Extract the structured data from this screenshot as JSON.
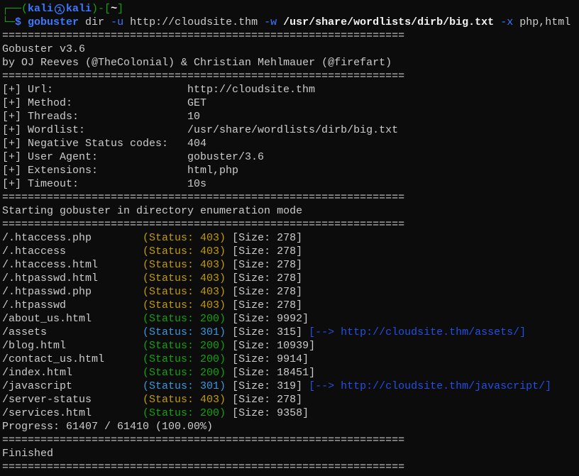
{
  "colors": {
    "background": "#0c0c0c",
    "foreground": "#cccccc",
    "bright_foreground": "#f2f2f2",
    "prompt_frame": "#13a10e",
    "prompt_user": "#3b78ff",
    "command_highlight": "#3b78ff",
    "redirect": "#2350e0",
    "status": {
      "200": "#13a10e",
      "301": "#3a96dd",
      "403": "#c19c00"
    }
  },
  "prompt": {
    "frame_open": "┌──(",
    "user": "kali",
    "symbol_icon": "korean-standard-symbol-icon",
    "host": "kali",
    "frame_mid": ")-[",
    "cwd": "~",
    "frame_close": "]",
    "frame_bottom": "└─",
    "sigil": "$"
  },
  "command": {
    "program": "gobuster",
    "mode": "dir",
    "url_flag": "-u",
    "url": "http://cloudsite.thm",
    "wordlist_flag": "-w",
    "wordlist": "/usr/share/wordlists/dirb/big.txt",
    "ext_flag": "-x",
    "extensions": "php,html"
  },
  "separator": "===============================================================",
  "banner": {
    "version": "Gobuster v3.6",
    "authors": "by OJ Reeves (@TheColonial) & Christian Mehlmauer (@firefart)"
  },
  "config": [
    {
      "label": "[+] Url:",
      "value": "http://cloudsite.thm"
    },
    {
      "label": "[+] Method:",
      "value": "GET"
    },
    {
      "label": "[+] Threads:",
      "value": "10"
    },
    {
      "label": "[+] Wordlist:",
      "value": "/usr/share/wordlists/dirb/big.txt"
    },
    {
      "label": "[+] Negative Status codes:",
      "value": "404"
    },
    {
      "label": "[+] User Agent:",
      "value": "gobuster/3.6"
    },
    {
      "label": "[+] Extensions:",
      "value": "html,php"
    },
    {
      "label": "[+] Timeout:",
      "value": "10s"
    }
  ],
  "start_message": "Starting gobuster in directory enumeration mode",
  "results": [
    {
      "path": "/.htaccess.php",
      "status": "(Status: 403)",
      "size": "[Size: 278]"
    },
    {
      "path": "/.htaccess",
      "status": "(Status: 403)",
      "size": "[Size: 278]"
    },
    {
      "path": "/.htaccess.html",
      "status": "(Status: 403)",
      "size": "[Size: 278]"
    },
    {
      "path": "/.htpasswd.html",
      "status": "(Status: 403)",
      "size": "[Size: 278]"
    },
    {
      "path": "/.htpasswd.php",
      "status": "(Status: 403)",
      "size": "[Size: 278]"
    },
    {
      "path": "/.htpasswd",
      "status": "(Status: 403)",
      "size": "[Size: 278]"
    },
    {
      "path": "/about_us.html",
      "status": "(Status: 200)",
      "size": "[Size: 9992]"
    },
    {
      "path": "/assets",
      "status": "(Status: 301)",
      "size": "[Size: 315]",
      "redirect": "[--> http://cloudsite.thm/assets/]"
    },
    {
      "path": "/blog.html",
      "status": "(Status: 200)",
      "size": "[Size: 10939]"
    },
    {
      "path": "/contact_us.html",
      "status": "(Status: 200)",
      "size": "[Size: 9914]"
    },
    {
      "path": "/index.html",
      "status": "(Status: 200)",
      "size": "[Size: 18451]"
    },
    {
      "path": "/javascript",
      "status": "(Status: 301)",
      "size": "[Size: 319]",
      "redirect": "[--> http://cloudsite.thm/javascript/]"
    },
    {
      "path": "/server-status",
      "status": "(Status: 403)",
      "size": "[Size: 278]"
    },
    {
      "path": "/services.html",
      "status": "(Status: 200)",
      "size": "[Size: 9358]"
    }
  ],
  "progress": "Progress: 61407 / 61410 (100.00%)",
  "finished": "Finished"
}
